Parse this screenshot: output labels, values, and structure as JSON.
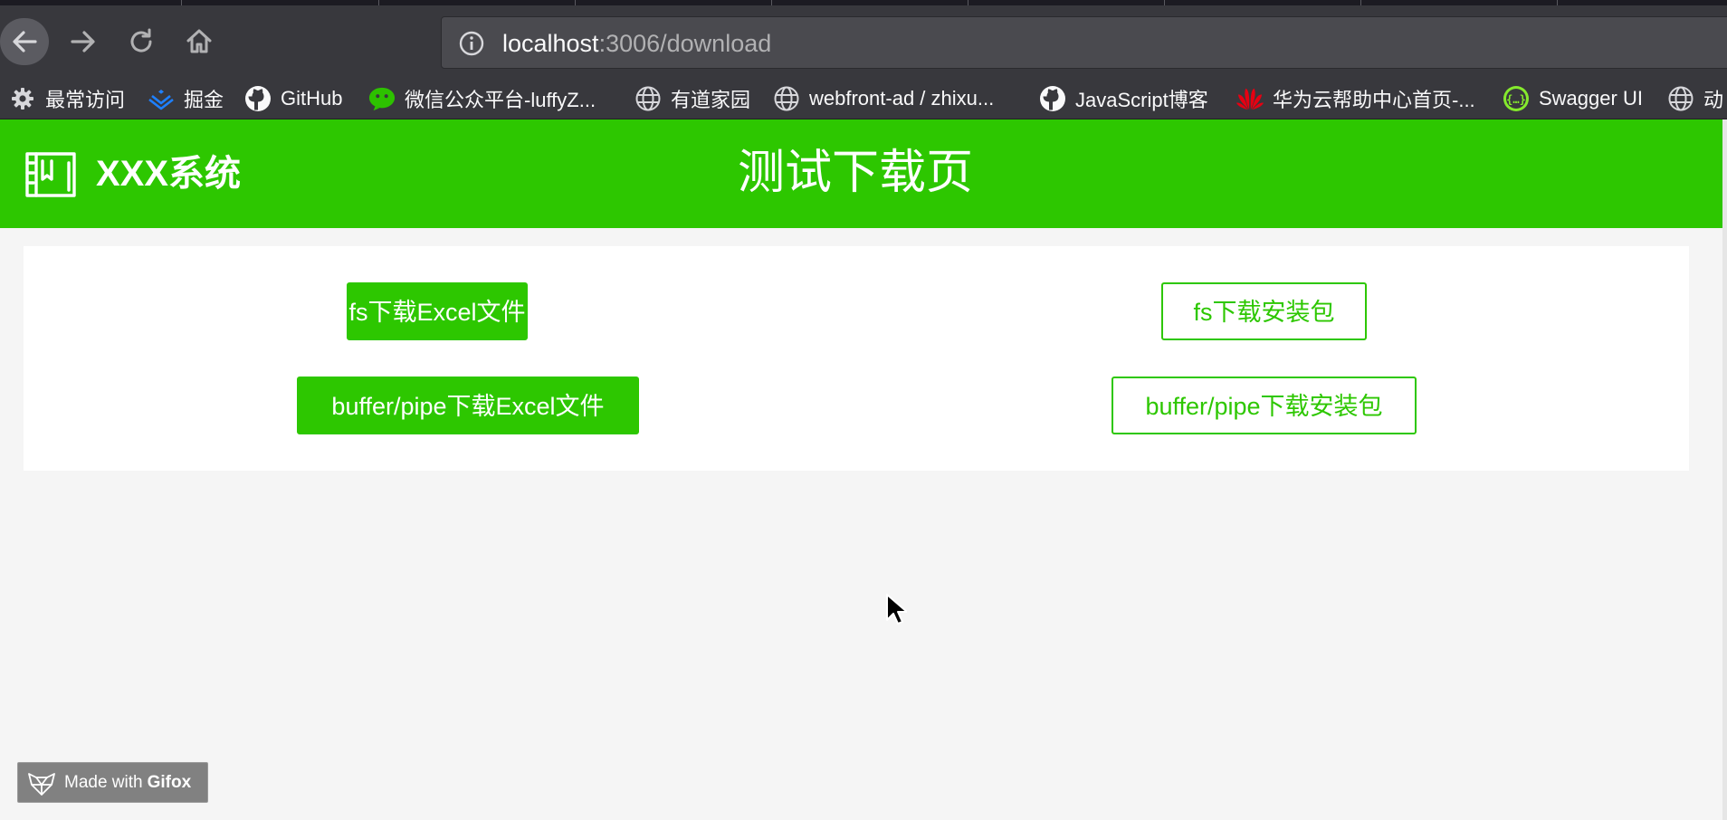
{
  "browser": {
    "url_host": "localhost",
    "url_path": ":3006/download",
    "bookmarks": [
      {
        "label": "最常访问",
        "icon": "gear-icon"
      },
      {
        "label": "掘金",
        "icon": "juejin-icon"
      },
      {
        "label": "GitHub",
        "icon": "github-icon"
      },
      {
        "label": "微信公众平台-luffyZ...",
        "icon": "wechat-icon"
      },
      {
        "label": "有道家园",
        "icon": "globe-icon"
      },
      {
        "label": "webfront-ad / zhixu...",
        "icon": "globe-icon"
      },
      {
        "label": "JavaScript博客",
        "icon": "github-icon"
      },
      {
        "label": "华为云帮助中心首页-...",
        "icon": "huawei-icon"
      },
      {
        "label": "Swagger UI",
        "icon": "swagger-icon"
      },
      {
        "label": "动",
        "icon": "globe-icon"
      }
    ]
  },
  "header": {
    "app_name": "XXX系统",
    "page_title": "测试下载页"
  },
  "buttons": {
    "fs_excel": "fs下载Excel文件",
    "buffer_excel": "buffer/pipe下载Excel文件",
    "fs_package": "fs下载安装包",
    "buffer_package": "buffer/pipe下载安装包"
  },
  "watermark": {
    "prefix": "Made with",
    "brand": "Gifox"
  },
  "colors": {
    "brand_green": "#2dc700",
    "chrome_dark": "#38383d"
  }
}
